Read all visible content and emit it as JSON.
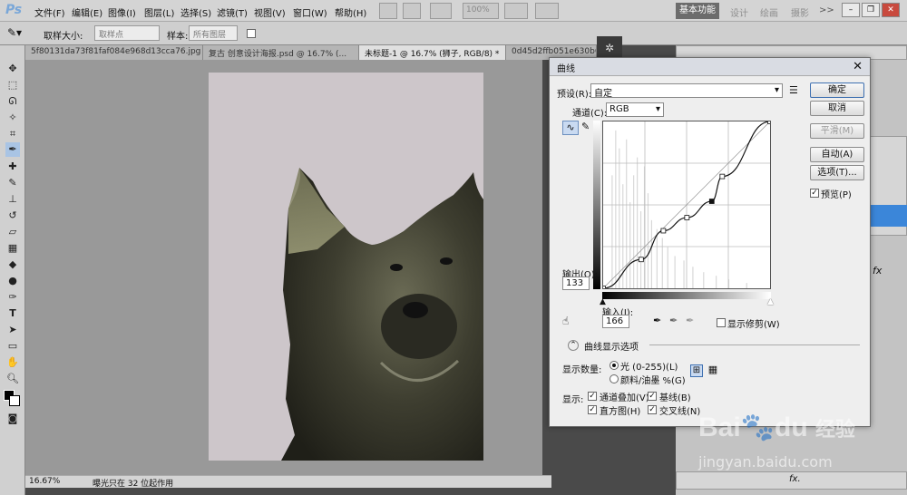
{
  "app": {
    "logo": "Ps"
  },
  "menu": [
    "文件(F)",
    "编辑(E)",
    "图像(I)",
    "图层(L)",
    "选择(S)",
    "滤镜(T)",
    "视图(V)",
    "窗口(W)",
    "帮助(H)"
  ],
  "toolbar_zoom": "100%",
  "workspaces": {
    "active": "基本功能",
    "items": [
      "设计",
      "绘画",
      "摄影"
    ],
    "more": ">>"
  },
  "options": {
    "sample_size_label": "取样大小:",
    "sample_size_value": "取样点",
    "sample_label": "样本:",
    "sample_value": "所有图层"
  },
  "tabs": [
    "5f80131da73f81faf084e968d13cca76.jpg",
    "复古 创意设计海报.psd @ 16.7% (...",
    "未标题-1 @ 16.7% (狮子, RGB/8) *",
    "0d45d2ffb051e630b67f  254d1d"
  ],
  "status": {
    "zoom": "16.67%",
    "message": "曝光只在 32 位起作用"
  },
  "dialog": {
    "title": "曲线",
    "preset_label": "预设(R):",
    "preset_value": "自定",
    "channel_label": "通道(C):",
    "channel_value": "RGB",
    "ok": "确定",
    "cancel": "取消",
    "smooth": "平滑(M)",
    "auto": "自动(A)",
    "options": "选项(T)...",
    "preview_label": "预览(P)",
    "output_label": "输出(O):",
    "output_value": "133",
    "input_label": "输入(I):",
    "input_value": "166",
    "show_clipping": "显示修剪(W)",
    "display_options": "曲线显示选项",
    "show_amount_label": "显示数量:",
    "light_option": "光 (0-255)(L)",
    "pigment_option": "颜料/油墨 %(G)",
    "show_label": "显示:",
    "channel_overlay": "通道叠加(V)",
    "baseline": "基线(B)",
    "histogram": "直方图(H)",
    "intersection": "交叉线(N)"
  },
  "curve_points": [
    [
      0,
      0
    ],
    [
      58,
      44
    ],
    [
      92,
      88
    ],
    [
      128,
      108
    ],
    [
      166,
      133
    ],
    [
      182,
      171
    ],
    [
      255,
      255
    ]
  ],
  "watermark": {
    "brand": "Bai",
    "brand2": "du",
    "cn": "经验",
    "url": "jingyan.baidu.com"
  }
}
